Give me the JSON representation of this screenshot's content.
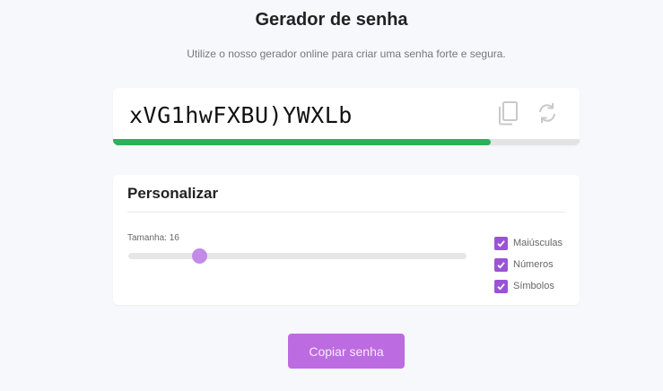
{
  "header": {
    "title": "Gerador de senha",
    "subtitle": "Utilize o nosso gerador online para criar uma senha forte e segura."
  },
  "password": {
    "value": "xVG1hwFXBU)YWXLb",
    "strength_fraction": 0.81,
    "strength_color": "#2bb15b",
    "copy_icon": "copy-icon",
    "refresh_icon": "refresh-icon"
  },
  "customize": {
    "title": "Personalizar",
    "size_label": "Tamanha: 16",
    "slider_fraction": 0.21,
    "options": [
      {
        "label": "Maiúsculas",
        "checked": true
      },
      {
        "label": "Números",
        "checked": true
      },
      {
        "label": "Símbolos",
        "checked": true
      }
    ]
  },
  "actions": {
    "copy_label": "Copiar senha"
  },
  "colors": {
    "accent": "#bd6be0",
    "checkbox": "#9a53d6",
    "slider_thumb": "#c28be8"
  }
}
